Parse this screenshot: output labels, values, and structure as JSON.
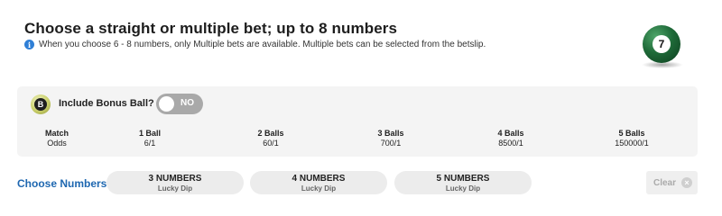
{
  "header": {
    "title": "Choose a straight or multiple bet; up to 8 numbers",
    "info_text": "When you choose 6 - 8 numbers, only Multiple bets are available. Multiple bets can be selected from the betslip.",
    "info_icon": "i",
    "ball_number": "7"
  },
  "bonus": {
    "badge_letter": "B",
    "label": "Include Bonus Ball?",
    "toggle_state": "NO"
  },
  "odds": [
    {
      "head": "Match",
      "value": "Odds"
    },
    {
      "head": "1 Ball",
      "value": "6/1"
    },
    {
      "head": "2 Balls",
      "value": "60/1"
    },
    {
      "head": "3 Balls",
      "value": "700/1"
    },
    {
      "head": "4 Balls",
      "value": "8500/1"
    },
    {
      "head": "5 Balls",
      "value": "150000/1"
    }
  ],
  "choose": {
    "label": "Choose Numbers",
    "buttons": [
      {
        "main": "3 NUMBERS",
        "sub": "Lucky Dip"
      },
      {
        "main": "4 NUMBERS",
        "sub": "Lucky Dip"
      },
      {
        "main": "5 NUMBERS",
        "sub": "Lucky Dip"
      }
    ],
    "clear_label": "Clear",
    "clear_icon": "×"
  },
  "colors": {
    "accent_blue": "#1e67b0",
    "info_blue": "#2f7fd6",
    "ball_green": "#1f6b39",
    "toggle_off": "#a9a9a9",
    "panel_bg": "#f4f4f4"
  }
}
